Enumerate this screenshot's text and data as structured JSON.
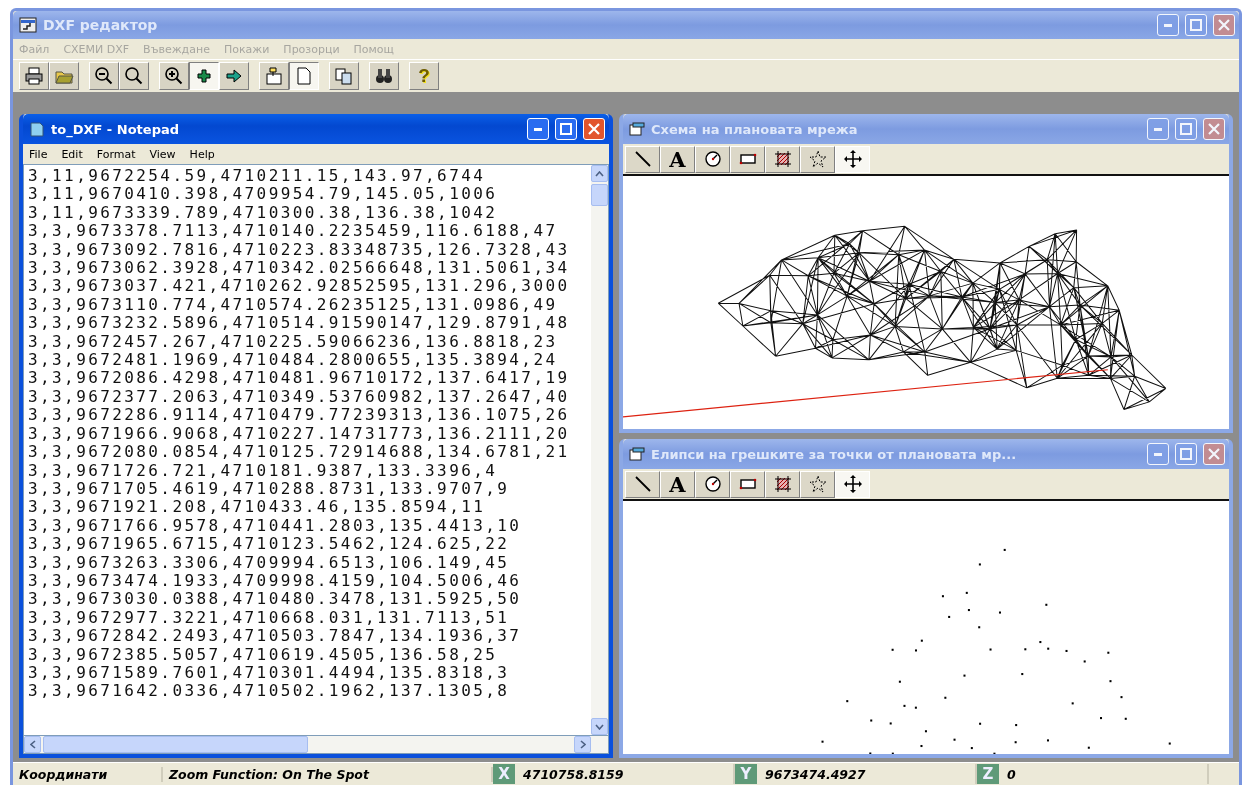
{
  "app": {
    "title": "DXF редактор",
    "active": false
  },
  "menu": [
    {
      "label": "Файл",
      "disabled": true
    },
    {
      "label": "СХЕМИ DXF",
      "disabled": true
    },
    {
      "label": "Въвеждане",
      "disabled": true
    },
    {
      "label": "Покажи",
      "disabled": true
    },
    {
      "label": "Прозорци",
      "disabled": true
    },
    {
      "label": "Помощ",
      "disabled": true
    }
  ],
  "toolbar": [
    [
      {
        "kind": "print",
        "pressed": false
      },
      {
        "kind": "open",
        "pressed": false
      }
    ],
    [
      {
        "kind": "zoom-out",
        "pressed": false
      },
      {
        "kind": "zoom",
        "pressed": false
      }
    ],
    [
      {
        "kind": "zoom-in",
        "pressed": false
      },
      {
        "kind": "plus",
        "pressed": true
      },
      {
        "kind": "arrow",
        "pressed": false
      }
    ],
    [
      {
        "kind": "import",
        "pressed": false
      },
      {
        "kind": "page",
        "pressed": true
      }
    ],
    [
      {
        "kind": "copy",
        "pressed": false
      }
    ],
    [
      {
        "kind": "find",
        "pressed": false
      }
    ],
    [
      {
        "kind": "help",
        "label": "?",
        "pressed": false
      }
    ]
  ],
  "notepad": {
    "title": "to_DXF - Notepad",
    "active": true,
    "menu": [
      "File",
      "Edit",
      "Format",
      "View",
      "Help"
    ],
    "lines": [
      "3,11,9672254.59,4710211.15,143.97,6744",
      "3,11,9670410.398,4709954.79,145.05,1006",
      "3,11,9673339.789,4710300.38,136.38,1042",
      "3,3,9673378.7113,4710140.2235459,116.6188,47",
      "3,3,9673092.7816,4710223.83348735,126.7328,43",
      "3,3,9673062.3928,4710342.02566648,131.5061,34",
      "3,3,9673037.421,4710262.92852595,131.296,3000",
      "3,3,9673110.774,4710574.26235125,131.0986,49",
      "3,3,9673232.5896,4710514.91590147,129.8791,48",
      "3,3,9672457.267,4710225.59066236,136.8818,23",
      "3,3,9672481.1969,4710484.2800655,135.3894,24",
      "3,3,9672086.4298,4710481.96710172,137.6417,19",
      "3,3,9672377.2063,4710349.53760982,137.2647,40",
      "3,3,9672286.9114,4710479.77239313,136.1075,26",
      "3,3,9671966.9068,4710227.14731773,136.2111,20",
      "3,3,9672080.0854,4710125.72914688,134.6781,21",
      "3,3,9671726.721,4710181.9387,133.3396,4",
      "3,3,9671705.4619,4710288.8731,133.9707,9",
      "3,3,9671921.208,4710433.46,135.8594,11",
      "3,3,9671766.9578,4710441.2803,135.4413,10",
      "3,3,9671965.6715,4710123.5462,124.625,22",
      "3,3,9673263.3306,4709994.6513,106.149,45",
      "3,3,9673474.1933,4709998.4159,104.5006,46",
      "3,3,9673030.0388,4710480.3478,131.5925,50",
      "3,3,9672977.3221,4710668.031,131.7113,51",
      "3,3,9672842.2493,4710503.7847,134.1936,37",
      "3,3,9672385.5057,4710619.4505,136.58,25",
      "3,3,9671589.7601,4710301.4494,135.8318,3",
      "3,3,9671642.0336,4710502.1962,137.1305,8"
    ]
  },
  "child_windows": [
    {
      "title": "Схема на плановата мрежа",
      "active": false,
      "kind": "mesh",
      "tools": [
        {
          "kind": "line",
          "selected": false
        },
        {
          "kind": "text",
          "label": "A",
          "selected": false
        },
        {
          "kind": "gauge",
          "selected": false
        },
        {
          "kind": "rect",
          "selected": false
        },
        {
          "kind": "hatch",
          "selected": false
        },
        {
          "kind": "star",
          "selected": false
        },
        {
          "kind": "move",
          "selected": true
        }
      ]
    },
    {
      "title": "Елипси на грешките за точки от плановата мр...",
      "active": false,
      "kind": "points",
      "tools": [
        {
          "kind": "line",
          "selected": false
        },
        {
          "kind": "text",
          "label": "A",
          "selected": false
        },
        {
          "kind": "gauge",
          "selected": false
        },
        {
          "kind": "rect",
          "selected": false
        },
        {
          "kind": "hatch",
          "selected": false
        },
        {
          "kind": "star",
          "selected": false
        },
        {
          "kind": "move",
          "selected": true
        }
      ]
    }
  ],
  "status_bar": {
    "label": "Координати",
    "mode": "Zoom Function: On The Spot",
    "coords": [
      {
        "axis": "X",
        "value": "4710758.8159"
      },
      {
        "axis": "Y",
        "value": "9673474.4927"
      },
      {
        "axis": "Z",
        "value": "0"
      }
    ]
  }
}
